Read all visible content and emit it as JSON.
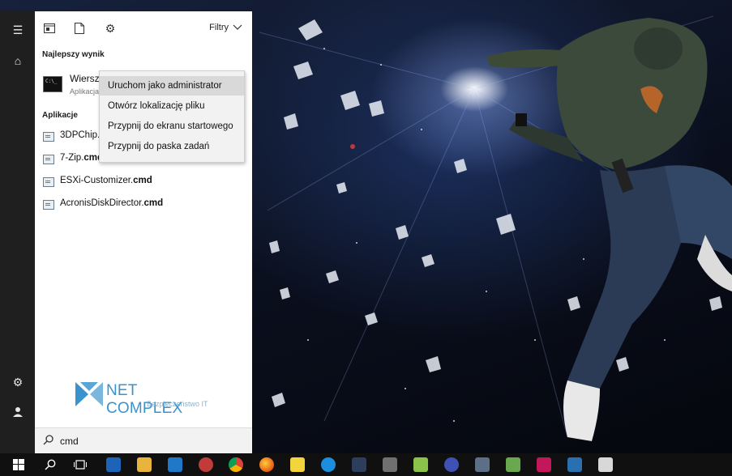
{
  "toolbar": {
    "filters_label": "Filtry"
  },
  "best_match": {
    "section_title": "Najlepszy wynik",
    "name": "Wiersz",
    "subtitle": "Aplikacja"
  },
  "apps": {
    "section_title": "Aplikacje",
    "items": [
      {
        "prefix": "3DPChip.",
        "suffix": ""
      },
      {
        "prefix": "7-Zip.",
        "suffix": "cmd"
      },
      {
        "prefix": "ESXi-Customizer.",
        "suffix": "cmd"
      },
      {
        "prefix": "AcronisDiskDirector.",
        "suffix": "cmd"
      }
    ]
  },
  "context_menu": {
    "items": [
      "Uruchom jako administrator",
      "Otwórz lokalizację pliku",
      "Przypnij do ekranu startowego",
      "Przypnij do paska zadań"
    ],
    "highlighted_index": 0
  },
  "logo": {
    "brand": "NET COMPLEX",
    "tagline": "Bezpieczeństwo IT"
  },
  "search": {
    "query": "cmd"
  },
  "colors": {
    "accent": "#3a93cc",
    "panel": "#ffffff",
    "rail": "#1f1f1f",
    "taskbar": "#101010"
  },
  "taskbar_apps": [
    "file-explorer-icon",
    "save-icon",
    "outlook-icon",
    "paint-icon",
    "chrome-icon",
    "firefox-icon",
    "sticky-notes-icon",
    "teamviewer-icon",
    "rdp-icon",
    "tools-icon",
    "sync-icon",
    "vpn-icon",
    "device-icon",
    "notepad-icon",
    "image-icon",
    "network-icon",
    "brush-icon"
  ]
}
